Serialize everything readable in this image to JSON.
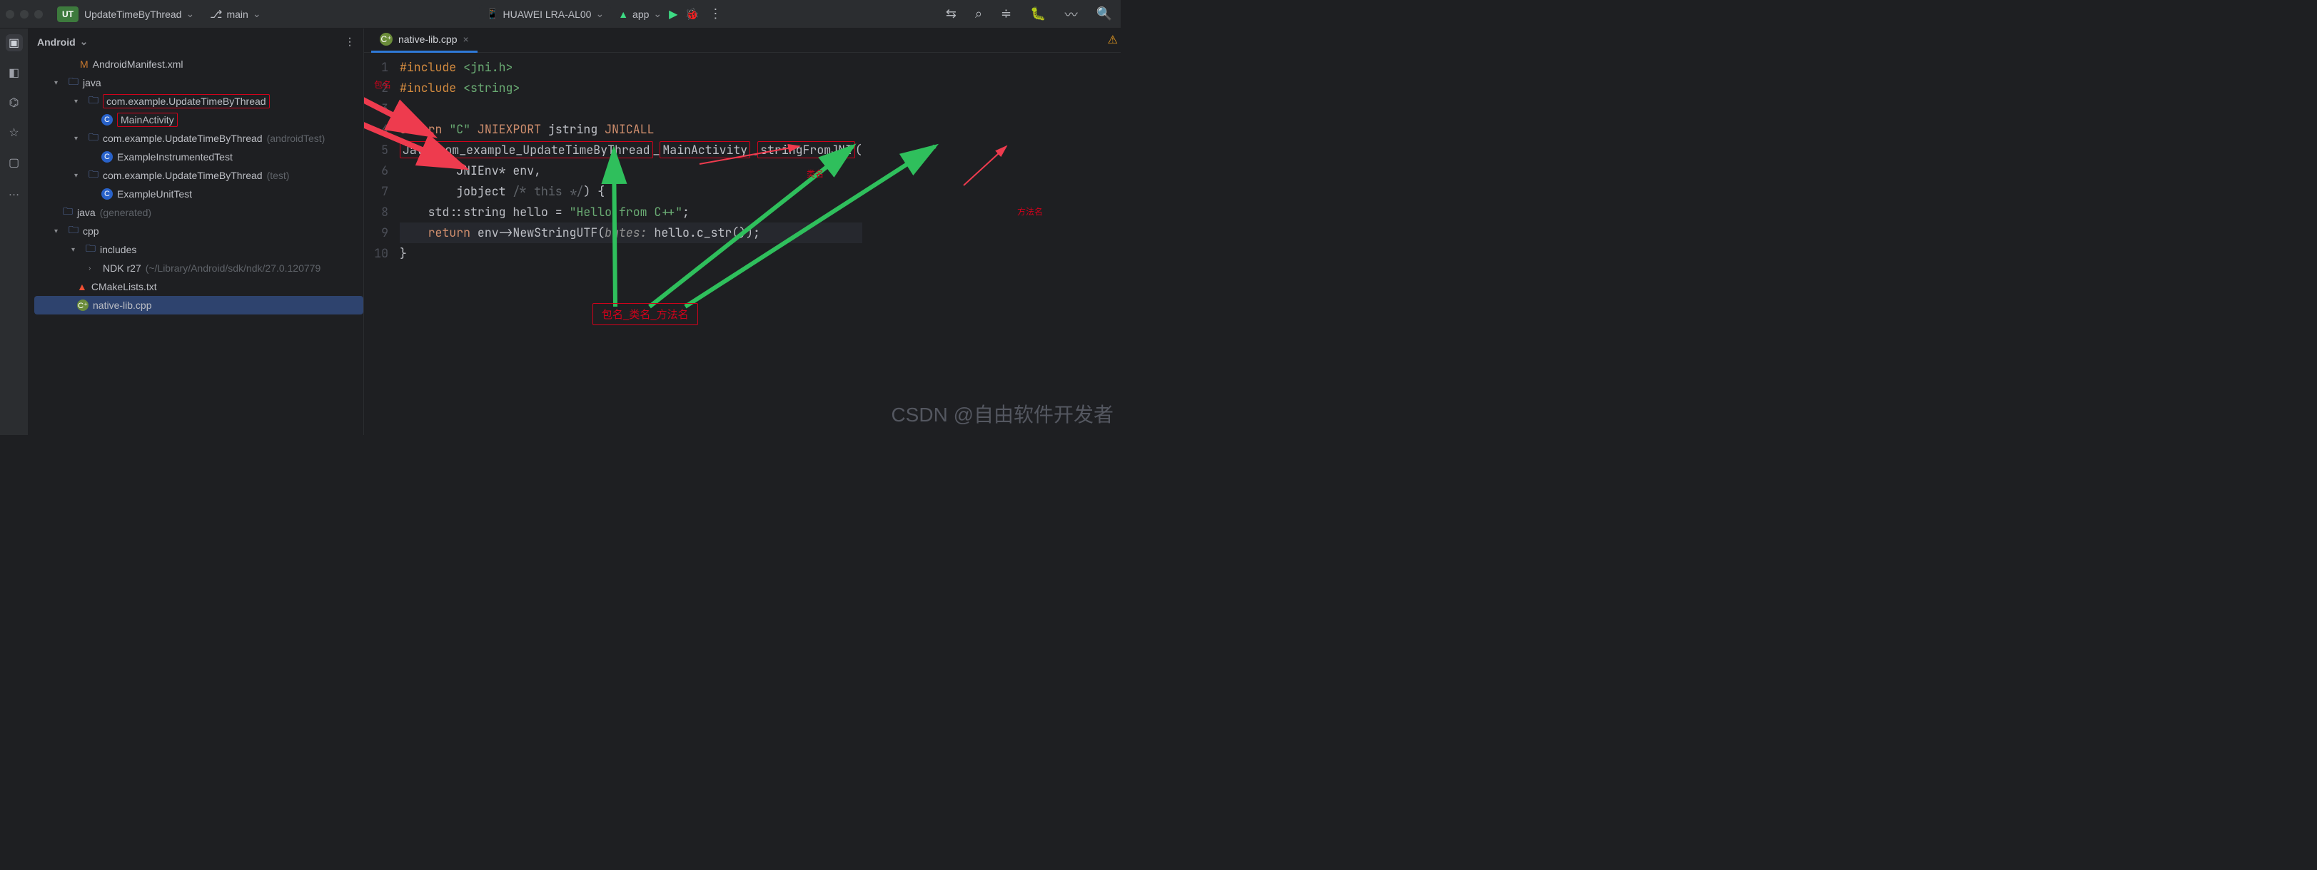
{
  "topbar": {
    "project_badge": "UT",
    "project_name": "UpdateTimeByThread",
    "branch": "main",
    "device": "HUAWEI LRA-AL00",
    "run_config": "app"
  },
  "sidebar": {
    "view_label": "Android",
    "tree": {
      "manifest": "AndroidManifest.xml",
      "java_dir": "java",
      "pkg_main": "com.example.UpdateTimeByThread",
      "main_activity": "MainActivity",
      "pkg_androidTest": "com.example.UpdateTimeByThread",
      "pkg_androidTest_suffix": "(androidTest)",
      "instrumented_test": "ExampleInstrumentedTest",
      "pkg_test": "com.example.UpdateTimeByThread",
      "pkg_test_suffix": "(test)",
      "unit_test": "ExampleUnitTest",
      "java_gen": "java",
      "java_gen_suffix": "(generated)",
      "cpp_dir": "cpp",
      "includes_dir": "includes",
      "ndk": "NDK r27",
      "ndk_suffix": "(~/Library/Android/sdk/ndk/27.0.120779",
      "cmake": "CMakeLists.txt",
      "nativelib": "native-lib.cpp"
    }
  },
  "editor": {
    "tab_name": "native-lib.cpp",
    "lines": [
      "1",
      "2",
      "3",
      "4",
      "5",
      "6",
      "7",
      "8",
      "9",
      "10"
    ],
    "code": {
      "l1_a": "#include ",
      "l1_b": "<jni.h>",
      "l2_a": "#include ",
      "l2_b": "<string>",
      "l4_a": "extern ",
      "l4_b": "\"C\"",
      "l4_c": " JNIEXPORT ",
      "l4_d": "jstring",
      "l4_e": " JNICALL",
      "l5_a": "Java_com_example_UpdateTimeByThread",
      "l5_b": "MainActivity",
      "l5_c": "stringFromJNI",
      "l6_a": "        JNIEnv* env,",
      "l7_a": "        jobject ",
      "l7_b": "/* this */",
      "l7_c": ") {",
      "l8_a": "    std::string hello = ",
      "l8_b": "\"Hello from C++\"",
      "l8_c": ";",
      "l9_a": "    ",
      "l9_b": "return",
      "l9_c": " env->NewStringUTF(",
      "l9_d": "bytes:",
      "l9_e": " hello.c_str());",
      "l10_a": "}"
    }
  },
  "annotations": {
    "pkg_label": "包名",
    "class_label": "类名",
    "method_label": "方法名",
    "formula": "包名_类名_方法名"
  },
  "watermark": "CSDN @自由软件开发者"
}
